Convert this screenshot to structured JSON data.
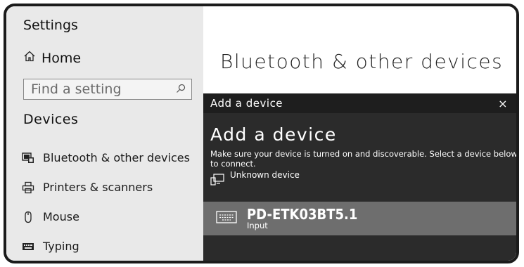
{
  "sidebar": {
    "app_title": "Settings",
    "home_label": "Home",
    "search_placeholder": "Find a setting",
    "section_title": "Devices",
    "items": [
      {
        "label": "Bluetooth & other devices",
        "icon": "bluetooth-devices-icon"
      },
      {
        "label": "Printers & scanners",
        "icon": "printer-icon"
      },
      {
        "label": "Mouse",
        "icon": "mouse-icon"
      },
      {
        "label": "Typing",
        "icon": "keyboard-icon"
      }
    ]
  },
  "main": {
    "page_title": "Bluetooth & other devices"
  },
  "dialog": {
    "window_title": "Add a device",
    "close_glyph": "×",
    "heading": "Add a device",
    "description": "Make sure your device is turned on and discoverable. Select a device below to connect.",
    "unknown_device_label": "Unknown device",
    "found_device": {
      "name": "PD-ETK03BT5.1",
      "type": "Input",
      "icon": "keyboard-icon"
    }
  },
  "colors": {
    "sidebar_bg": "#e9e9e9",
    "dialog_bg": "#2b2b2b",
    "dialog_titlebar_bg": "#1e1e1e",
    "device_tile_bg": "#6e6e6e"
  }
}
